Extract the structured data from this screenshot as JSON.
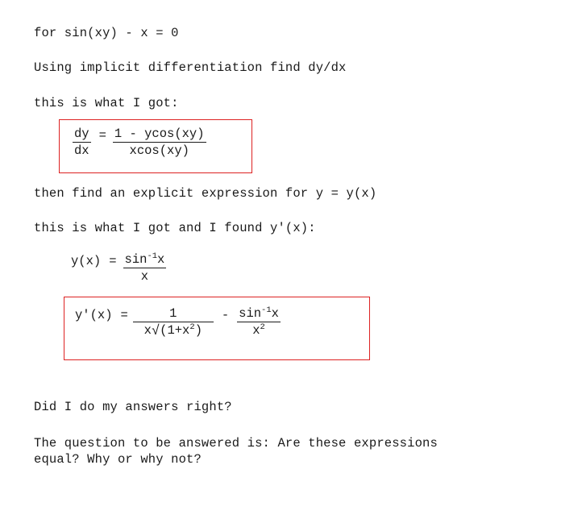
{
  "document": {
    "kind": "math-homework-question",
    "background_color": "#ffffff",
    "text_color": "#1a1a1a",
    "highlight_box_color": "#dd2222"
  },
  "lines": {
    "problem_statement": "for sin(xy) - x = 0",
    "instruction": "Using implicit differentiation find dy/dx",
    "my_work_intro": "this is what I got:",
    "next_instruction": "then find an explicit expression for y = y(x)",
    "second_work_intro": "this is what I got and I found y'(x):",
    "check_question": "Did I do my answers right?",
    "final_question": "The question to be answered is: Are these expressions\nequal? Why or why not?"
  },
  "equations": {
    "dydx": {
      "boxed": true,
      "lhs_numerator": "dy",
      "lhs_denominator": "dx",
      "equals": "=",
      "rhs_numerator": "1 - ycos(xy)",
      "rhs_denominator": "xcos(xy)",
      "plain": "dy/dx = (1 - ycos(xy)) / (xcos(xy))"
    },
    "y_of_x": {
      "boxed": false,
      "lhs": "y(x)",
      "equals": "=",
      "numerator_base": "sin",
      "numerator_exponent": "-1",
      "numerator_arg": "x",
      "denominator": "x",
      "plain": "y(x) = sin^-1 x / x"
    },
    "y_prime": {
      "boxed": true,
      "lhs": "y'(x)",
      "equals": "=",
      "term1_numerator": "1",
      "term1_denominator_prefix": "x",
      "term1_radical": "√",
      "term1_radicand": "(1+x",
      "term1_radicand_exponent": "2",
      "term1_radicand_close": ")",
      "operator": "-",
      "term2_numerator_base": "sin",
      "term2_numerator_exponent": "-1",
      "term2_numerator_arg": "x",
      "term2_denominator_base": "x",
      "term2_denominator_exponent": "2",
      "plain": "y'(x) = 1/(x√(1+x^2)) - sin^-1 x / x^2"
    }
  }
}
